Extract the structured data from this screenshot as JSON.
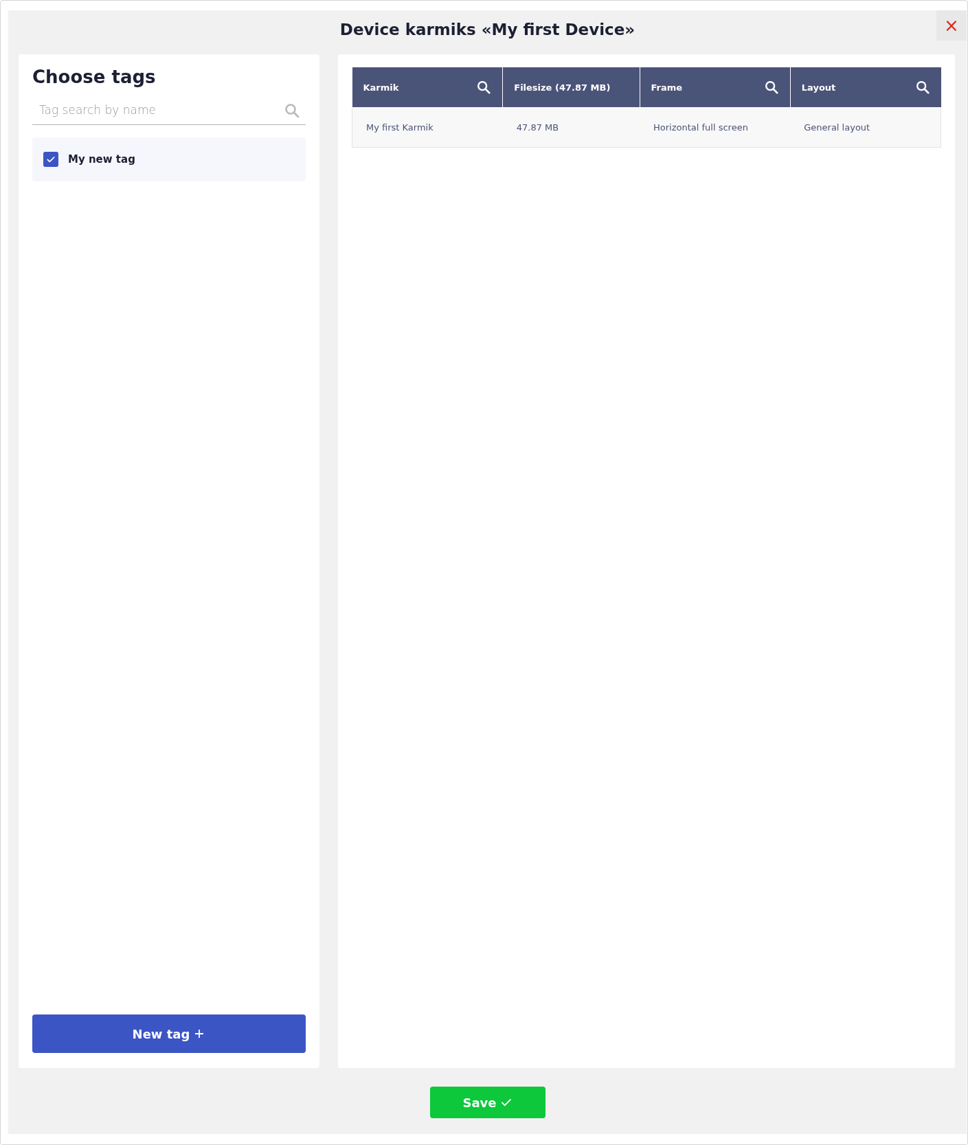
{
  "dialog": {
    "title": "Device karmiks «My first Device»",
    "close_label": "×"
  },
  "tags_panel": {
    "heading": "Choose tags",
    "search": {
      "placeholder": "Tag search by name"
    },
    "tags": [
      {
        "label": "My new tag",
        "checked": true
      }
    ],
    "new_button": {
      "label": "New tag"
    }
  },
  "table": {
    "columns": [
      {
        "label": "Karmik",
        "searchable": true
      },
      {
        "label": "Filesize (47.87 MB)",
        "searchable": false
      },
      {
        "label": "Frame",
        "searchable": true
      },
      {
        "label": "Layout",
        "searchable": true
      }
    ],
    "rows": [
      [
        "My first Karmik",
        "47.87 MB",
        "Horizontal full screen",
        "General layout"
      ]
    ]
  },
  "save_button": {
    "label": "Save"
  }
}
